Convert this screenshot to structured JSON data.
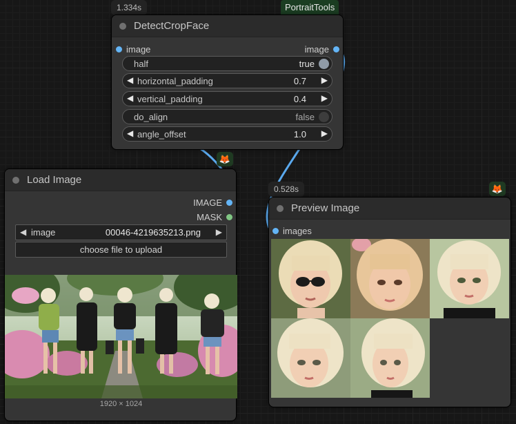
{
  "detect_node": {
    "time_badge": "1.334s",
    "pack_badge": "PortraitTools",
    "title": "DetectCropFace",
    "input_label": "image",
    "output_label": "image",
    "widgets": [
      {
        "label": "half",
        "value": "true",
        "kind": "toggle",
        "on": true
      },
      {
        "label": "horizontal_padding",
        "value": "0.7",
        "kind": "number"
      },
      {
        "label": "vertical_padding",
        "value": "0.4",
        "kind": "number"
      },
      {
        "label": "do_align",
        "value": "false",
        "kind": "toggle",
        "on": false
      },
      {
        "label": "angle_offset",
        "value": "1.0",
        "kind": "number"
      }
    ]
  },
  "load_node": {
    "title": "Load Image",
    "outputs": [
      "IMAGE",
      "MASK"
    ],
    "image_widget": {
      "label": "image",
      "value": "00046-4219635213.png"
    },
    "upload_label": "choose file to upload",
    "dimensions": "1920 × 1024"
  },
  "preview_node": {
    "time_badge": "0.528s",
    "title": "Preview Image",
    "input_label": "images",
    "thumbnail_count": 5
  },
  "icons": {
    "node_badge": "fox-icon",
    "decrement": "left-arrow-icon",
    "increment": "right-arrow-icon"
  },
  "colors": {
    "canvas_bg": "#171717",
    "node_bg": "#353535",
    "node_title_bg": "#2b2b2b",
    "image_link": "#64b5f6",
    "mask_link": "#81c784",
    "pack_badge_bg": "#1b3d22"
  }
}
